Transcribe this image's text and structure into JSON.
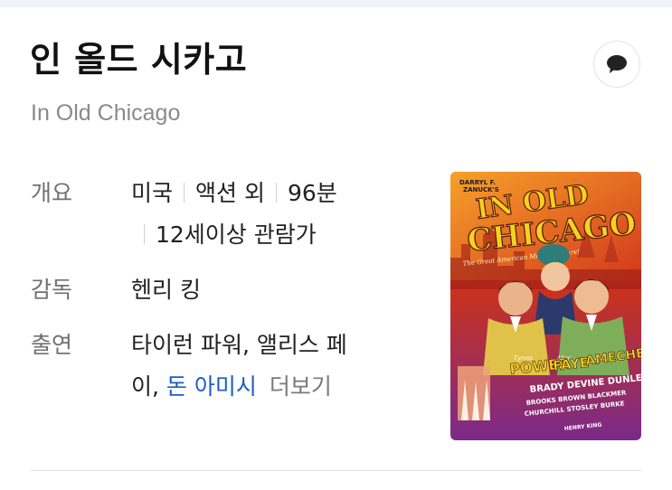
{
  "title": "인 올드 시카고",
  "subtitle": "In Old Chicago",
  "overview": {
    "label": "개요",
    "country": "미국",
    "genre": "액션 외",
    "runtime": "96분",
    "rating": "12세이상 관람가"
  },
  "director": {
    "label": "감독",
    "value": "헨리 킹"
  },
  "cast": {
    "label": "출연",
    "text_line1": "타이런 파워, 앨리스 페",
    "text_line2": "이,",
    "link": "돈 아미시",
    "more": "더보기"
  },
  "poster": {
    "producer": "DARRYL F. ZANUCK'S",
    "title_line1": "IN OLD",
    "title_line2": "CHICAGO",
    "tagline": "The Great American Motion Picture!",
    "stars": [
      "POWER",
      "FAYE",
      "AMECHE"
    ],
    "star_prefixes": [
      "Tyrone",
      "Alice",
      "Don"
    ],
    "supporting": [
      "BRADY",
      "DEVINE",
      "DUNLEVY"
    ],
    "supporting2": [
      "BROOKS",
      "BROWN",
      "BLACKMER"
    ],
    "supporting3": [
      "CHURCHILL",
      "STOSLEY",
      "BURKE"
    ],
    "director_credit": "HENRY KING"
  },
  "colors": {
    "link": "#1a5ec7",
    "poster_bg": "#c8321f",
    "poster_title": "#f6d21c"
  },
  "icons": {
    "chat": "speech-bubble-icon"
  }
}
